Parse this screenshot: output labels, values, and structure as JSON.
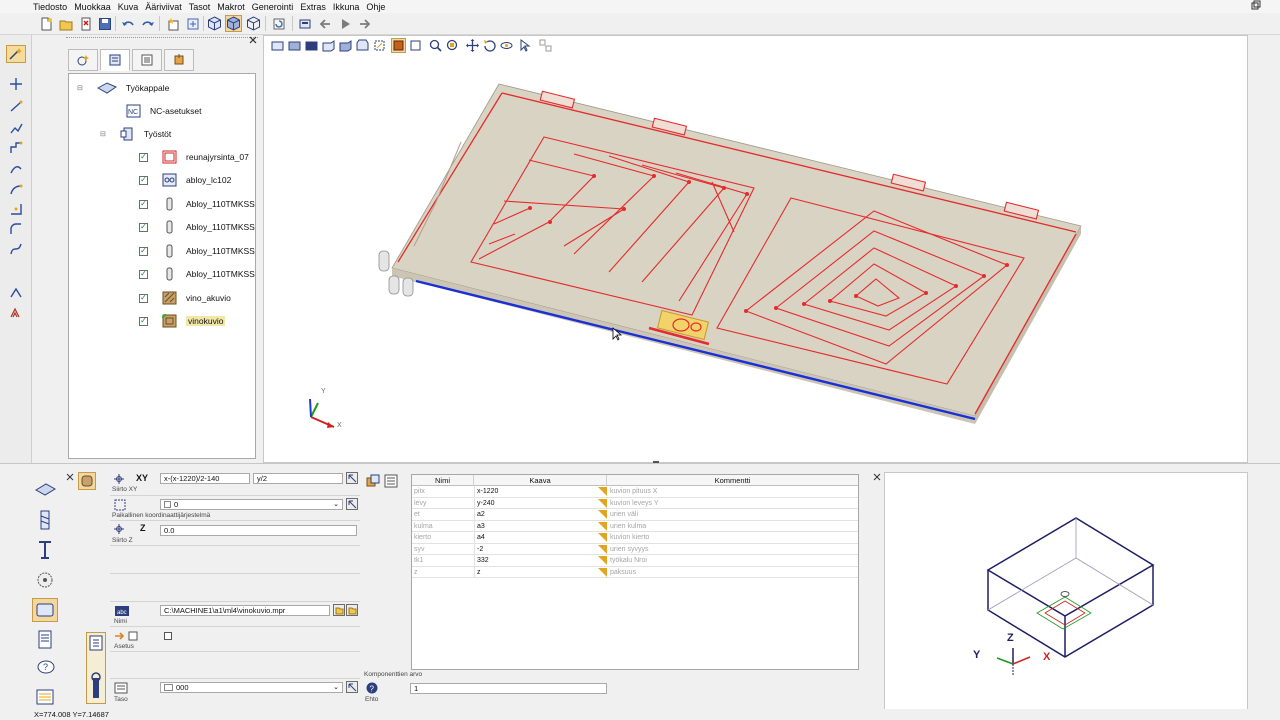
{
  "menubar": {
    "items": [
      "Tiedosto",
      "Muokkaa",
      "Kuva",
      "Ääriviivat",
      "Tasot",
      "Makrot",
      "Generointi",
      "Extras",
      "Ikkuna",
      "Ohje"
    ]
  },
  "tree": {
    "root": "Työkappale",
    "nc_settings": "NC-asetukset",
    "operations_group": "Työstöt",
    "operations": [
      {
        "label": "reunajyrsinta_07",
        "checked": true,
        "icon": "edge-mill-icon"
      },
      {
        "label": "abloy_lc102",
        "checked": true,
        "icon": "lock-pocket-icon"
      },
      {
        "label": "Abloy_110TMKSS",
        "checked": true,
        "icon": "drill-icon"
      },
      {
        "label": "Abloy_110TMKSS",
        "checked": true,
        "icon": "drill-icon"
      },
      {
        "label": "Abloy_110TMKSS",
        "checked": true,
        "icon": "drill-icon"
      },
      {
        "label": "Abloy_110TMKSS",
        "checked": true,
        "icon": "drill-icon"
      },
      {
        "label": "vino_akuvio",
        "checked": true,
        "icon": "pattern-icon"
      },
      {
        "label": "vinokuvio",
        "checked": true,
        "icon": "pattern-icon",
        "selected": true
      }
    ]
  },
  "viewport": {
    "axes": {
      "x": "X",
      "y": "Y"
    }
  },
  "form": {
    "xy_label": "XY",
    "xy_x": "x-(x-1220)/2-140",
    "xy_y": "y/2",
    "xy_caption": "Siirto XY",
    "coord_value": "0",
    "coord_caption": "Paikallinen koordinaattijärjestelmä",
    "z_label": "Z",
    "z_value": "0.0",
    "z_caption": "Siirto Z",
    "name_value": "C:\\MACHINE1\\a1\\ml4\\vinokuvio.mpr",
    "name_caption": "Nimi",
    "setting_caption": "Asetus",
    "level_value": "000",
    "level_caption": "Taso"
  },
  "table": {
    "headers": [
      "Nimi",
      "Kaava",
      "Kommentti"
    ],
    "rows": [
      {
        "name": "pitx",
        "formula": "x-1220",
        "comment": "kuvion pituus X"
      },
      {
        "name": "levy",
        "formula": "y-240",
        "comment": "kuvion leveys Y"
      },
      {
        "name": "et",
        "formula": "a2",
        "comment": "urien väli"
      },
      {
        "name": "kulma",
        "formula": "a3",
        "comment": "urien kulma"
      },
      {
        "name": "kierto",
        "formula": "a4",
        "comment": "kuvion kierto"
      },
      {
        "name": "syv",
        "formula": "-2",
        "comment": "urien syvyys"
      },
      {
        "name": "tk1",
        "formula": "332",
        "comment": "työkalu Nroi"
      },
      {
        "name": "z",
        "formula": "z",
        "comment": "paksuus"
      }
    ]
  },
  "component": {
    "caption": "Komponenttien arvo",
    "condition_caption": "Ehto",
    "condition_value": "1"
  },
  "preview": {
    "axes": {
      "x": "X",
      "y": "Y",
      "z": "Z"
    }
  },
  "status": {
    "coords": "X=774.008 Y=7.14687"
  },
  "colors": {
    "toolpath": "#e52b2b",
    "edge_blue": "#1a2fd6",
    "board": "#d9d3c4",
    "selection": "#f1d36a"
  }
}
